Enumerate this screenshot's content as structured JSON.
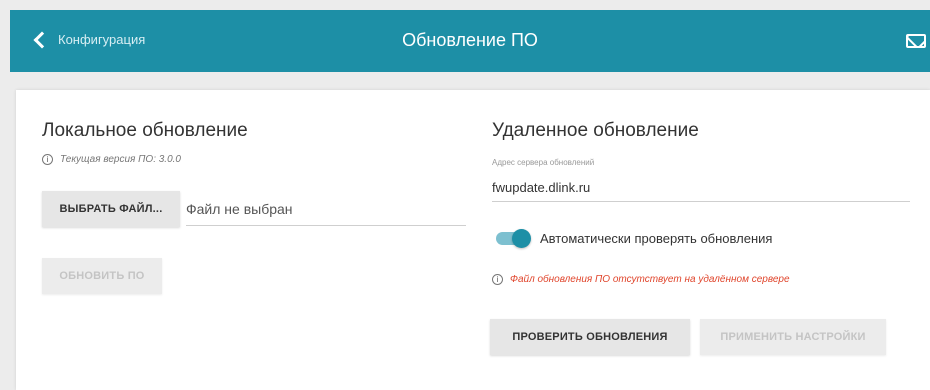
{
  "header": {
    "back_label": "Конфигурация",
    "title": "Обновление ПО",
    "color": "#1d8fa6"
  },
  "local_update": {
    "title": "Локальное обновление",
    "firmware_info": "Текущая версия ПО: 3.0.0",
    "choose_file_button": "ВЫБРАТЬ ФАЙЛ...",
    "file_status": "Файл не выбран",
    "update_button": "ОБНОВИТЬ ПО"
  },
  "remote_update": {
    "title": "Удаленное обновление",
    "server_label": "Адрес сервера обновлений",
    "server_value": "fwupdate.dlink.ru",
    "auto_check_label": "Автоматически проверять обновления",
    "auto_check_enabled": true,
    "error_message": "Файл обновления ПО отсутствует на удалённом сервере",
    "check_button": "ПРОВЕРИТЬ ОБНОВЛЕНИЯ",
    "apply_button": "ПРИМЕНИТЬ НАСТРОЙКИ"
  },
  "icons": {
    "back": "chevron-left-icon",
    "mail": "mail-icon",
    "info": "info-icon"
  }
}
